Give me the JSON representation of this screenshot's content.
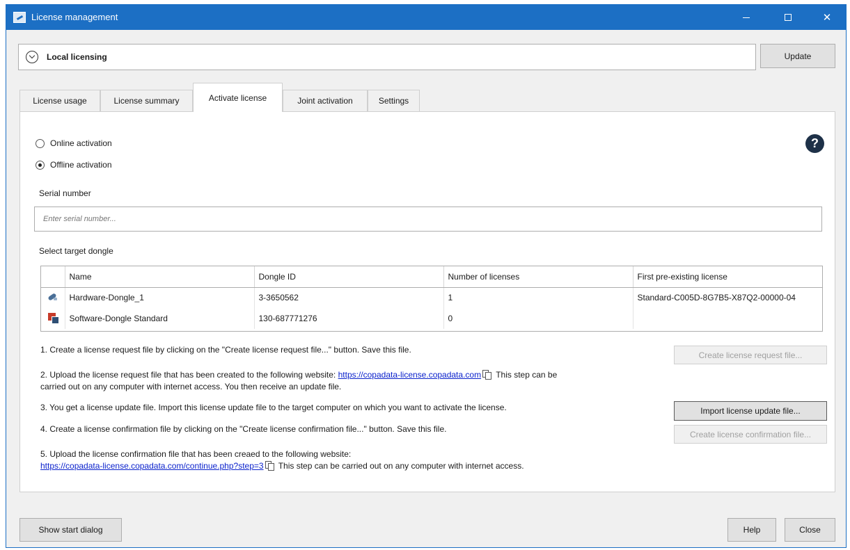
{
  "window": {
    "title": "License management",
    "minimize_glyph": "—",
    "maximize_glyph": "☐",
    "close_glyph": "✕"
  },
  "section": {
    "title": "Local licensing",
    "update_label": "Update"
  },
  "tabs": [
    {
      "label": "License usage",
      "active": false
    },
    {
      "label": "License summary",
      "active": false
    },
    {
      "label": "Activate license",
      "active": true
    },
    {
      "label": "Joint activation",
      "active": false
    },
    {
      "label": "Settings",
      "active": false
    }
  ],
  "activation": {
    "online_label": "Online activation",
    "offline_label": "Offline activation",
    "selected": "offline",
    "help_glyph": "?"
  },
  "serial": {
    "label": "Serial number",
    "placeholder": "Enter serial number...",
    "value": ""
  },
  "dongles": {
    "label": "Select target dongle",
    "columns": [
      "",
      "Name",
      "Dongle ID",
      "Number of licenses",
      "First pre-existing license"
    ],
    "rows": [
      {
        "icon": "hardware-dongle-icon",
        "name": "Hardware-Dongle_1",
        "dongle_id": "3-3650562",
        "licenses": "1",
        "first_license": "Standard-C005D-8G7B5-X87Q2-00000-04"
      },
      {
        "icon": "software-dongle-icon",
        "name": "Software-Dongle Standard",
        "dongle_id": "130-687771276",
        "licenses": "0",
        "first_license": ""
      }
    ]
  },
  "steps": {
    "s1": "1. Create a license request file by clicking on the \"Create license request file...\" button. Save this file.",
    "s2_pre": "2. Upload the license request file that has been created to the following website:",
    "s2_link": "https://copadata-license.copadata.com",
    "s2_post": "This step can be",
    "s2_line2": "carried out on any computer with internet access. You then receive an update file.",
    "s3": "3. You get a license update file. Import this license update file to the target computer on which you want to activate the license.",
    "s4": "4. Create a license confirmation file by clicking on the \"Create license confirmation file...\" button. Save this file.",
    "s5_line1": "5. Upload the license confirmation file that has been creaed to the following website:",
    "s5_link": "https://copadata-license.copadata.com/continue.php?step=3",
    "s5_post": "This step can be carried out on any computer with internet access."
  },
  "actions": {
    "create_request": "Create license request file...",
    "import_update": "Import license update file...",
    "create_confirmation": "Create license confirmation file..."
  },
  "footer": {
    "show_start": "Show start dialog",
    "help": "Help",
    "close": "Close"
  }
}
